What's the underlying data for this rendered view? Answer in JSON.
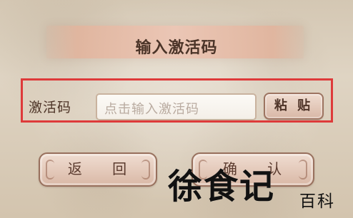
{
  "dialog": {
    "title": "输入激活码",
    "field_label": "激活码",
    "input_placeholder": "点击输入激活码",
    "paste_label": "粘 贴",
    "back_label": "返 回",
    "confirm_label": "确 认"
  },
  "watermark": {
    "main": "徐食记",
    "sub": "百科"
  },
  "colors": {
    "accent_red": "#de3a3a",
    "button_fill": "#e8cfc1",
    "title_band": "#ebc6b5",
    "text_brown": "#4b3428"
  }
}
